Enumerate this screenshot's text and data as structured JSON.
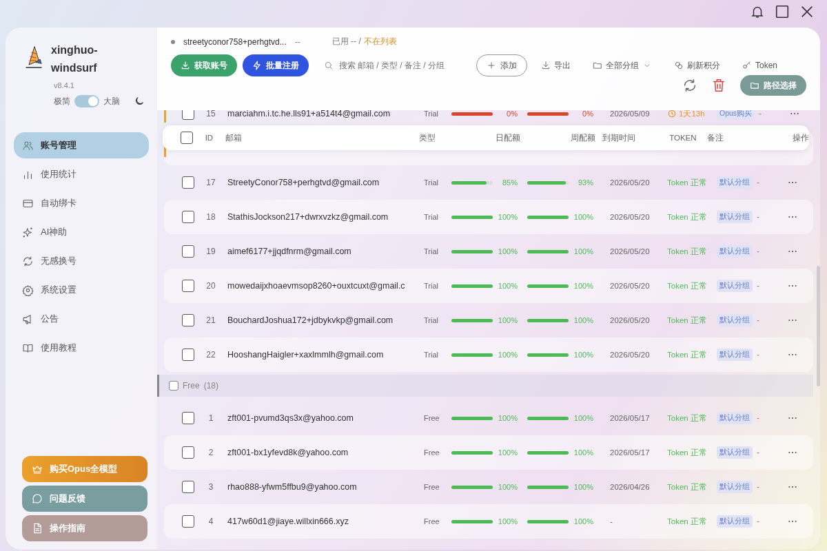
{
  "app": {
    "name": "xinghuo-windsurf",
    "version": "v8.4.1",
    "mode_left": "极简",
    "mode_right": "大脑",
    "mode_on": true
  },
  "nav": [
    {
      "label": "账号管理",
      "selected": true
    },
    {
      "label": "使用统计",
      "selected": false
    },
    {
      "label": "自动绑卡",
      "selected": false
    },
    {
      "label": "AI神助",
      "selected": false
    },
    {
      "label": "无感换号",
      "selected": false
    },
    {
      "label": "系统设置",
      "selected": false
    },
    {
      "label": "公告",
      "selected": false
    },
    {
      "label": "使用教程",
      "selected": false
    }
  ],
  "sidebar_buttons": [
    {
      "label": "购买Opus全模型",
      "kind": "crown"
    },
    {
      "label": "问题反馈",
      "kind": "chat"
    },
    {
      "label": "操作指南",
      "kind": "doc"
    }
  ],
  "current": {
    "account": "streetyconor758+perhgtvd...",
    "credits": "--",
    "used": "已用 -- /",
    "status": "不在列表"
  },
  "toolbar": {
    "fetch": "获取账号",
    "batch": "批量注册",
    "search_placeholder": "搜索 邮箱 / 类型 / 备注 / 分组",
    "add": "添加",
    "export": "导出",
    "groups": "全部分组",
    "refresh_credits": "刷新积分",
    "token": "Token",
    "path": "路径选择"
  },
  "select_all_checked": false,
  "columns": [
    "ID",
    "邮箱",
    "类型",
    "日配额",
    "周配额",
    "到期时间",
    "TOKEN",
    "备注",
    "操作"
  ],
  "sections": [
    {
      "rows": [
        {
          "id": "15",
          "checked": false,
          "email": "marciahm.i.tc.he.lls91+a514t4@gmail.com",
          "type": "Trial",
          "flagged": true,
          "daily": {
            "level": 1,
            "reading": "0%",
            "color": "#d9472e"
          },
          "weekly": {
            "level": 1,
            "reading": "0%",
            "color": "#d9472e"
          },
          "expires": "2026/05/09",
          "token": {
            "kind": "timer",
            "text": "1天13h"
          },
          "tag": "Opus购买",
          "note": "-"
        },
        {
          "flagged": true
        },
        {
          "id": "17",
          "checked": false,
          "email": "StreetyConor758+perhgtvd@gmail.com",
          "type": "Trial",
          "flagged": false,
          "daily": {
            "level": 0.85,
            "reading": "85%",
            "color": "#4cbb55"
          },
          "weekly": {
            "level": 0.93,
            "reading": "93%",
            "color": "#4cbb55"
          },
          "expires": "2026/05/20",
          "token": {
            "kind": "ok",
            "text": "Token 正常"
          },
          "tag": "默认分组",
          "note": "-"
        },
        {
          "id": "18",
          "checked": false,
          "email": "StathisJockson217+dwrxvzkz@gmail.com",
          "type": "Trial",
          "flagged": false,
          "daily": {
            "level": 1,
            "reading": "100%",
            "color": "#4cbb55"
          },
          "weekly": {
            "level": 1,
            "reading": "100%",
            "color": "#4cbb55"
          },
          "expires": "2026/05/20",
          "token": {
            "kind": "ok",
            "text": "Token 正常"
          },
          "tag": "默认分组",
          "note": "-"
        },
        {
          "id": "19",
          "checked": false,
          "email": "aimef6177+jjqdfnrm@gmail.com",
          "type": "Trial",
          "flagged": false,
          "daily": {
            "level": 1,
            "reading": "100%",
            "color": "#4cbb55"
          },
          "weekly": {
            "level": 1,
            "reading": "100%",
            "color": "#4cbb55"
          },
          "expires": "2026/05/20",
          "token": {
            "kind": "ok",
            "text": "Token 正常"
          },
          "tag": "默认分组",
          "note": "-"
        },
        {
          "id": "20",
          "checked": false,
          "email": "mowedaijxhoaevmsop8260+ouxtcuxt@gmail.c",
          "type": "Trial",
          "flagged": false,
          "daily": {
            "level": 1,
            "reading": "100%",
            "color": "#4cbb55"
          },
          "weekly": {
            "level": 1,
            "reading": "100%",
            "color": "#4cbb55"
          },
          "expires": "2026/05/20",
          "token": {
            "kind": "ok",
            "text": "Token 正常"
          },
          "tag": "默认分组",
          "note": "-"
        },
        {
          "id": "21",
          "checked": false,
          "email": "BouchardJoshua172+jdbykvkp@gmail.com",
          "type": "Trial",
          "flagged": false,
          "daily": {
            "level": 1,
            "reading": "100%",
            "color": "#4cbb55"
          },
          "weekly": {
            "level": 1,
            "reading": "100%",
            "color": "#4cbb55"
          },
          "expires": "2026/05/20",
          "token": {
            "kind": "ok",
            "text": "Token 正常"
          },
          "tag": "默认分组",
          "note": "-"
        },
        {
          "id": "22",
          "checked": false,
          "email": "HooshangHaigler+xaxlmmlh@gmail.com",
          "type": "Trial",
          "flagged": false,
          "daily": {
            "level": 1,
            "reading": "100%",
            "color": "#4cbb55"
          },
          "weekly": {
            "level": 1,
            "reading": "100%",
            "color": "#4cbb55"
          },
          "expires": "2026/05/20",
          "token": {
            "kind": "ok",
            "text": "Token 正常"
          },
          "tag": "默认分组",
          "note": "-"
        }
      ]
    },
    {
      "title": "Free",
      "count": "(18)",
      "checked": false,
      "rows": [
        {
          "id": "1",
          "checked": false,
          "email": "zft001-pvumd3qs3x@yahoo.com",
          "type": "Free",
          "flagged": false,
          "daily": {
            "level": 1,
            "reading": "100%",
            "color": "#4cbb55"
          },
          "weekly": {
            "level": 1,
            "reading": "100%",
            "color": "#4cbb55"
          },
          "expires": "2026/05/17",
          "token": {
            "kind": "ok",
            "text": "Token 正常"
          },
          "tag": "默认分组",
          "note": "-"
        },
        {
          "id": "2",
          "checked": false,
          "email": "zft001-bx1yfevd8k@yahoo.com",
          "type": "Free",
          "flagged": false,
          "daily": {
            "level": 1,
            "reading": "100%",
            "color": "#4cbb55"
          },
          "weekly": {
            "level": 1,
            "reading": "100%",
            "color": "#4cbb55"
          },
          "expires": "2026/05/17",
          "token": {
            "kind": "ok",
            "text": "Token 正常"
          },
          "tag": "默认分组",
          "note": "-"
        },
        {
          "id": "3",
          "checked": false,
          "email": "rhao888-yfwm5ffbu9@yahoo.com",
          "type": "Free",
          "flagged": false,
          "daily": {
            "level": 1,
            "reading": "100%",
            "color": "#4cbb55"
          },
          "weekly": {
            "level": 1,
            "reading": "100%",
            "color": "#4cbb55"
          },
          "expires": "2026/04/26",
          "token": {
            "kind": "ok",
            "text": "Token 正常"
          },
          "tag": "默认分组",
          "note": "-"
        },
        {
          "id": "4",
          "checked": false,
          "email": "417w60d1@jiaye.willxin666.xyz",
          "type": "Free",
          "flagged": false,
          "daily": {
            "level": 1,
            "reading": "100%",
            "color": "#4cbb55"
          },
          "weekly": {
            "level": 1,
            "reading": "100%",
            "color": "#4cbb55"
          },
          "expires": "-",
          "token": {
            "kind": "ok",
            "text": "Token 正常"
          },
          "tag": "默认分组",
          "note": "-"
        }
      ]
    }
  ]
}
